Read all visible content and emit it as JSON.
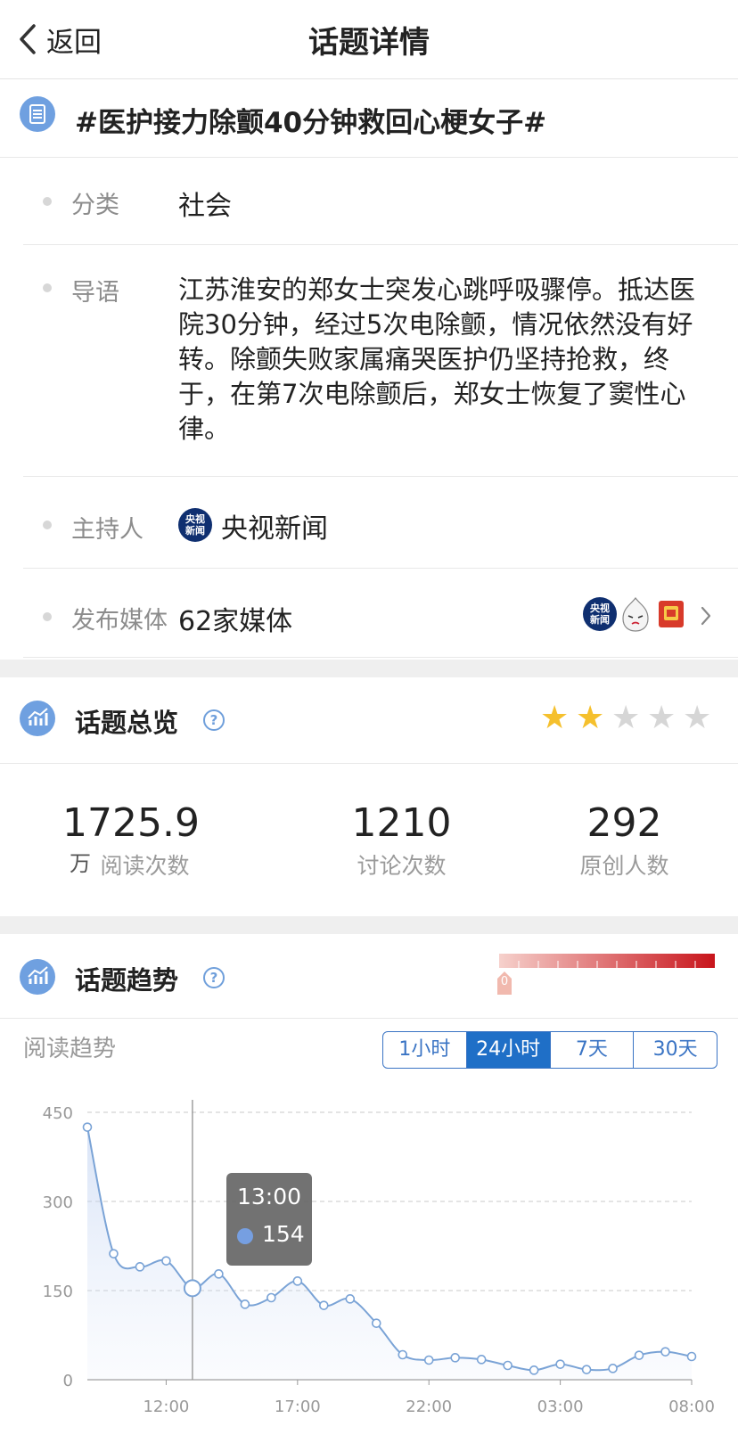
{
  "nav": {
    "back_label": "返回",
    "title": "话题详情"
  },
  "topic": {
    "title": "#医护接力除颤40分钟救回心梗女子#"
  },
  "info": {
    "category_label": "分类",
    "category_value": "社会",
    "intro_label": "导语",
    "intro_text": "江苏淮安的郑女士突发心跳呼吸骤停。抵达医院30分钟，经过5次电除颤，情况依然没有好转。除颤失败家属痛哭医护仍坚持抢救，终于，在第7次电除颤后，郑女士恢复了窦性心律。",
    "host_label": "主持人",
    "host_name": "央视新闻",
    "media_label": "发布媒体",
    "media_value": "62家媒体"
  },
  "logo": {
    "line1": "央视",
    "line2": "新闻"
  },
  "overview": {
    "title": "话题总览",
    "help": "?",
    "rating": 2,
    "rating_max": 5,
    "star_on_color": "#f5c02d",
    "star_off_color": "#d6d6d6",
    "stats": [
      {
        "value": "1725.9",
        "unit": "万",
        "label": "阅读次数"
      },
      {
        "value": "1210",
        "unit": "",
        "label": "讨论次数"
      },
      {
        "value": "292",
        "unit": "",
        "label": "原创人数"
      }
    ]
  },
  "trend": {
    "title": "话题趋势",
    "help": "?",
    "heat_marker": "0",
    "sub_label": "阅读趋势",
    "tabs": [
      "1小时",
      "24小时",
      "7天",
      "30天"
    ],
    "active_tab": 1
  },
  "tooltip": {
    "time": "13:00",
    "value": "154"
  },
  "chart_data": {
    "type": "line",
    "x": [
      "09:00",
      "10:00",
      "11:00",
      "12:00",
      "13:00",
      "14:00",
      "15:00",
      "16:00",
      "17:00",
      "18:00",
      "19:00",
      "20:00",
      "21:00",
      "22:00",
      "23:00",
      "00:00",
      "01:00",
      "02:00",
      "03:00",
      "04:00",
      "05:00",
      "06:00",
      "07:00",
      "08:00"
    ],
    "series": [
      {
        "values": [
          425,
          212,
          190,
          200,
          154,
          178,
          127,
          138,
          166,
          125,
          136,
          95,
          42,
          33,
          37,
          34,
          24,
          16,
          26,
          17,
          19,
          41,
          47,
          39
        ]
      }
    ],
    "xtick_labels": [
      "12:00",
      "17:00",
      "22:00",
      "03:00",
      "08:00"
    ],
    "ytick_labels": [
      "0",
      "150",
      "300",
      "450"
    ],
    "ylim": [
      0,
      450
    ],
    "grid": true,
    "line_color": "#7aa3d6",
    "highlight_index": 4
  }
}
